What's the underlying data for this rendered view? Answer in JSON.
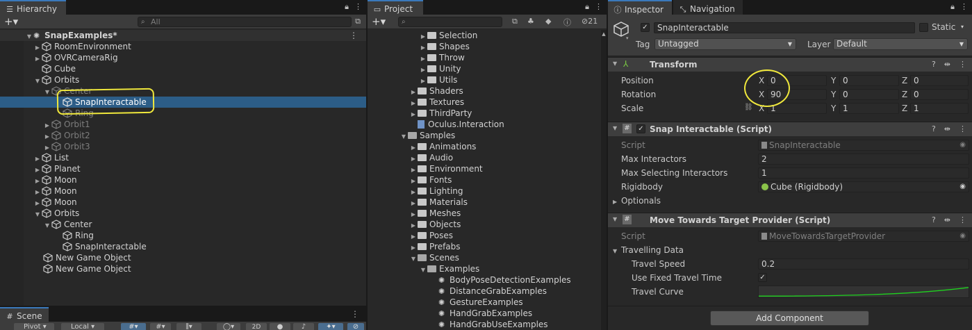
{
  "hierarchy": {
    "tab_label": "Hierarchy",
    "search_placeholder": "All",
    "rows": [
      {
        "label": "SnapExamples*"
      },
      {
        "label": "RoomEnvironment"
      },
      {
        "label": "OVRCameraRig"
      },
      {
        "label": "Cube"
      },
      {
        "label": "Orbits"
      },
      {
        "label": "Center"
      },
      {
        "label": "SnapInteractable"
      },
      {
        "label": "Ring"
      },
      {
        "label": "Orbit1"
      },
      {
        "label": "Orbit2"
      },
      {
        "label": "Orbit3"
      },
      {
        "label": "List"
      },
      {
        "label": "Planet"
      },
      {
        "label": "Moon"
      },
      {
        "label": "Moon"
      },
      {
        "label": "Moon"
      },
      {
        "label": "Orbits"
      },
      {
        "label": "Center"
      },
      {
        "label": "Ring"
      },
      {
        "label": "SnapInteractable"
      },
      {
        "label": "New Game Object"
      },
      {
        "label": "New Game Object"
      }
    ]
  },
  "scene": {
    "tab_label": "Scene",
    "toolbar": {
      "pivot": "Pivot",
      "local": "Local",
      "mode_2d": "2D"
    }
  },
  "project": {
    "tab_label": "Project",
    "hidden_count": "21",
    "rows": [
      {
        "label": "Selection"
      },
      {
        "label": "Shapes"
      },
      {
        "label": "Throw"
      },
      {
        "label": "Unity"
      },
      {
        "label": "Utils"
      },
      {
        "label": "Shaders"
      },
      {
        "label": "Textures"
      },
      {
        "label": "ThirdParty"
      },
      {
        "label": "Oculus.Interaction"
      },
      {
        "label": "Samples"
      },
      {
        "label": "Animations"
      },
      {
        "label": "Audio"
      },
      {
        "label": "Environment"
      },
      {
        "label": "Fonts"
      },
      {
        "label": "Lighting"
      },
      {
        "label": "Materials"
      },
      {
        "label": "Meshes"
      },
      {
        "label": "Objects"
      },
      {
        "label": "Poses"
      },
      {
        "label": "Prefabs"
      },
      {
        "label": "Scenes"
      },
      {
        "label": "Examples"
      },
      {
        "label": "BodyPoseDetectionExamples"
      },
      {
        "label": "DistanceGrabExamples"
      },
      {
        "label": "GestureExamples"
      },
      {
        "label": "HandGrabExamples"
      },
      {
        "label": "HandGrabUseExamples"
      }
    ]
  },
  "inspector": {
    "tab_label": "Inspector",
    "nav_tab_label": "Navigation",
    "object_name": "SnapInteractable",
    "static_label": "Static",
    "tag_label": "Tag",
    "tag_value": "Untagged",
    "layer_label": "Layer",
    "layer_value": "Default",
    "transform": {
      "title": "Transform",
      "position_label": "Position",
      "rotation_label": "Rotation",
      "scale_label": "Scale",
      "x": "X",
      "y": "Y",
      "z": "Z",
      "position": [
        "0",
        "0",
        "0"
      ],
      "rotation": [
        "90",
        "0",
        "0"
      ],
      "scale": [
        "1",
        "1",
        "1"
      ]
    },
    "snap": {
      "title": "Snap Interactable (Script)",
      "script_label": "Script",
      "script_value": "SnapInteractable",
      "max_interactors_label": "Max Interactors",
      "max_interactors": "2",
      "max_selecting_label": "Max Selecting Interactors",
      "max_selecting": "1",
      "rigidbody_label": "Rigidbody",
      "rigidbody_value": "Cube (Rigidbody)",
      "optionals_label": "Optionals"
    },
    "move": {
      "title": "Move Towards Target Provider (Script)",
      "script_label": "Script",
      "script_value": "MoveTowardsTargetProvider",
      "travelling_label": "Travelling Data",
      "travel_speed_label": "Travel Speed",
      "travel_speed": "0.2",
      "fixed_time_label": "Use Fixed Travel Time",
      "travel_curve_label": "Travel Curve"
    },
    "add_component": "Add Component"
  },
  "colors": {
    "selection": "#2c5d87",
    "highlight": "#f0e83c",
    "curve": "#1fd21f"
  }
}
